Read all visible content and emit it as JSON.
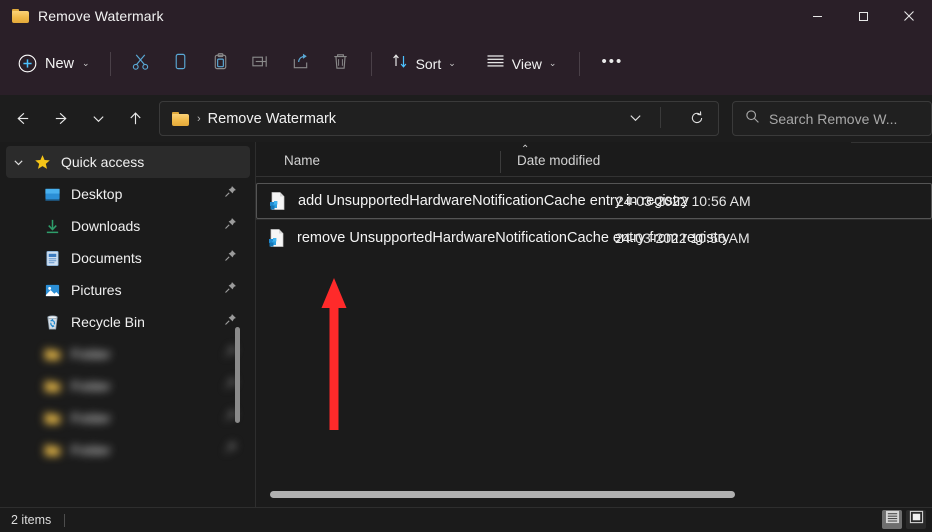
{
  "window": {
    "title": "Remove Watermark",
    "folder_icon": "folder-icon",
    "controls": {
      "minimize": "minimize-icon",
      "maximize": "maximize-icon",
      "close": "close-icon"
    }
  },
  "toolbar": {
    "new_label": "New",
    "new_icon": "plus-circle-icon",
    "new_chevron": "⌄",
    "cut_icon": "scissors-icon",
    "copy_icon": "copy-icon",
    "paste_icon": "paste-icon",
    "rename_icon": "rename-icon",
    "share_icon": "share-icon",
    "delete_icon": "trash-icon",
    "sort_label": "Sort",
    "sort_icon": "sort-arrows-icon",
    "sort_chevron": "⌄",
    "view_label": "View",
    "view_icon": "lines-icon",
    "view_chevron": "⌄",
    "more_label": "•••"
  },
  "address": {
    "back_icon": "arrow-left-icon",
    "forward_icon": "arrow-right-icon",
    "recent_icon": "chevron-down-icon",
    "up_icon": "arrow-up-icon",
    "folder_icon": "folder-icon",
    "separator": "›",
    "path_label": "Remove Watermark",
    "dropdown_icon": "chevron-down-icon",
    "refresh_icon": "refresh-icon"
  },
  "search": {
    "icon": "search-icon",
    "placeholder": "Search Remove W..."
  },
  "sidebar": {
    "items": [
      {
        "label": "Quick access",
        "icon": "star-icon",
        "pinned": false,
        "expanded": true,
        "selected": true,
        "blurred": false
      },
      {
        "label": "Desktop",
        "icon": "desktop-icon",
        "pinned": true,
        "blurred": false
      },
      {
        "label": "Downloads",
        "icon": "download-icon",
        "pinned": true,
        "blurred": false
      },
      {
        "label": "Documents",
        "icon": "document-icon",
        "pinned": true,
        "blurred": false
      },
      {
        "label": "Pictures",
        "icon": "pictures-icon",
        "pinned": true,
        "blurred": false
      },
      {
        "label": "Recycle Bin",
        "icon": "recycle-bin-icon",
        "pinned": true,
        "blurred": false
      },
      {
        "label": "Folder",
        "icon": "folder-icon",
        "pinned": true,
        "blurred": true
      },
      {
        "label": "Folder",
        "icon": "folder-icon",
        "pinned": true,
        "blurred": true
      },
      {
        "label": "Folder",
        "icon": "folder-icon",
        "pinned": true,
        "blurred": true
      },
      {
        "label": "Folder",
        "icon": "folder-icon",
        "pinned": true,
        "blurred": true
      }
    ]
  },
  "filelist": {
    "columns": [
      {
        "key": "name",
        "label": "Name",
        "sorted": "ascending",
        "sort_mark": "⌃"
      },
      {
        "key": "date",
        "label": "Date modified",
        "sorted": null
      }
    ],
    "rows": [
      {
        "icon": "registry-file-icon",
        "name": "add UnsupportedHardwareNotificationCache entry in registry",
        "date": "24-03-2022 10:56 AM",
        "focused": true
      },
      {
        "icon": "registry-file-icon",
        "name": "remove UnsupportedHardwareNotificationCache entry from registry",
        "date": "24-03-2022 10:56 AM",
        "focused": false
      }
    ]
  },
  "status": {
    "items_text": "2 items",
    "details_view_icon": "details-view-icon",
    "large_icons_view_icon": "large-icons-view-icon"
  },
  "annotation": {
    "arrow_icon": "red-up-arrow-icon",
    "arrow_color": "#ff2a2a"
  },
  "colors": {
    "titlebar": "#2a1f28",
    "body": "#1b1b1b",
    "accent": "#4cc2ff",
    "folder": "#f0b949",
    "annotation": "#ff2a2a"
  }
}
